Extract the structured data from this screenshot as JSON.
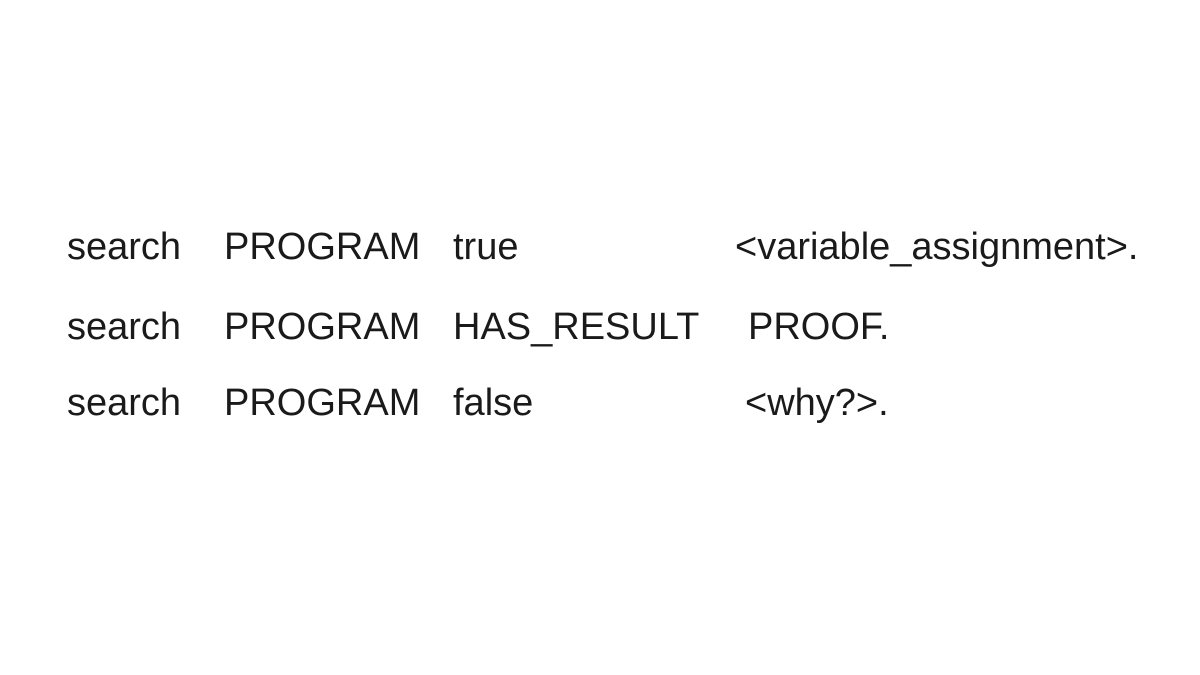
{
  "rows": [
    {
      "command": "search",
      "program": "PROGRAM",
      "result": "true",
      "output": "<variable_assignment>."
    },
    {
      "command": "search",
      "program": "PROGRAM",
      "result": "HAS_RESULT",
      "output": "PROOF."
    },
    {
      "command": "search",
      "program": "PROGRAM",
      "result": "false",
      "output": "<why?>."
    }
  ]
}
